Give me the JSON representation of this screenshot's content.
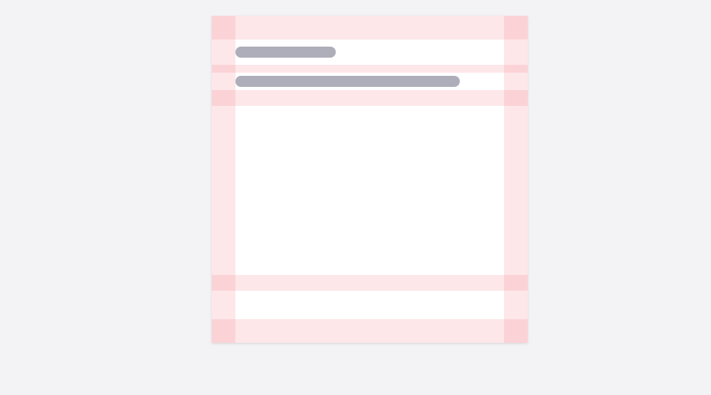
{
  "page": {
    "background_color": "#f3f3f5"
  },
  "card": {
    "background_color": "#ffffff",
    "padding_overlay_color": "#fde7e9",
    "padding_overlay_corner_color": "#fbd3d7",
    "header": {
      "title_skeleton": "",
      "subtitle_skeleton": ""
    },
    "body": {
      "content": ""
    },
    "footer": {
      "content": ""
    },
    "skeleton_color": "#aeaeba"
  }
}
